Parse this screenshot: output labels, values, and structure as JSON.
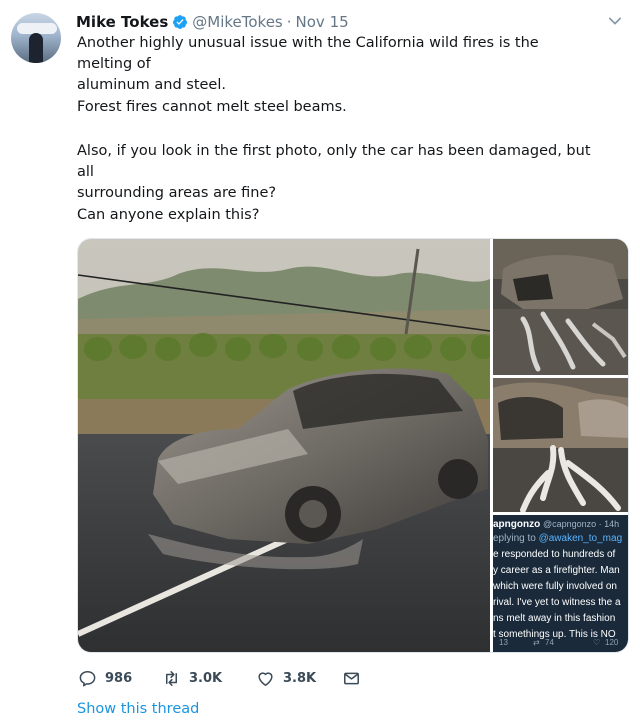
{
  "tweet": {
    "author_name": "Mike Tokes",
    "author_handle": "@MikeTokes",
    "separator": "·",
    "date": "Nov 15",
    "text_1a": "Another highly unusual issue with the California wild fires is the melting of",
    "text_1b": "aluminum and steel.",
    "text_2": "Forest fires cannot melt steel beams.",
    "text_3a": "Also, if you look in the first photo, only the car has been damaged, but all",
    "text_3b": "surrounding areas are fine?",
    "text_4": "Can anyone explain this?"
  },
  "embedded_tweet": {
    "lines": [
      {
        "user": "apngonzo",
        "handle": "@capngonzo · 14h"
      },
      {
        "prefix": "eplying to ",
        "mention": "@awaken_to_mag"
      },
      "e responded to hundreds of",
      "y career as a firefighter. Man",
      " which were fully involved on",
      "rival. I've yet to witness the a",
      "ns melt away in this fashion",
      "t somethings up. This is NO"
    ],
    "stats": {
      "replies": "13",
      "retweets": "74",
      "likes": "120"
    }
  },
  "actions": {
    "reply_count": "986",
    "retweet_count": "3.0K",
    "like_count": "3.8K"
  },
  "show_thread_label": "Show this thread",
  "icons": {
    "verified": "verified-badge-icon",
    "caret": "chevron-down-icon",
    "reply": "reply-icon",
    "retweet": "retweet-icon",
    "like": "heart-icon",
    "dm": "envelope-icon"
  },
  "colors": {
    "text": "#14171a",
    "muted": "#657786",
    "link": "#1b95e0",
    "verified": "#1da1f2"
  }
}
